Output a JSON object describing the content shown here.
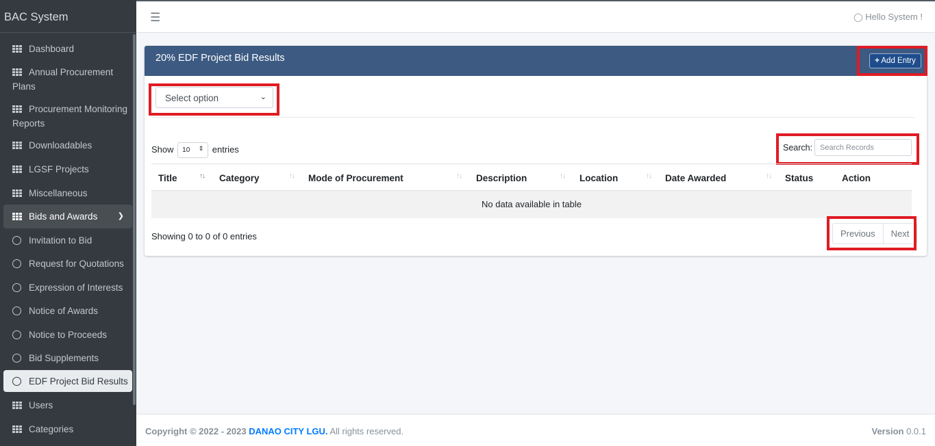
{
  "brand": "BAC System",
  "sidebar": {
    "items": [
      {
        "label": "Dashboard",
        "icon": "grid-icon"
      },
      {
        "label": "Annual Procurement Plans",
        "icon": "grid-icon"
      },
      {
        "label": "Procurement Monitoring Reports",
        "icon": "grid-icon"
      },
      {
        "label": "Downloadables",
        "icon": "grid-icon"
      },
      {
        "label": "LGSF Projects",
        "icon": "grid-icon"
      },
      {
        "label": "Miscellaneous",
        "icon": "grid-icon"
      },
      {
        "label": "Bids and Awards",
        "icon": "grid-icon"
      },
      {
        "label": "Invitation to Bid",
        "icon": "circle-icon"
      },
      {
        "label": "Request for Quotations",
        "icon": "circle-icon"
      },
      {
        "label": "Expression of Interests",
        "icon": "circle-icon"
      },
      {
        "label": "Notice of Awards",
        "icon": "circle-icon"
      },
      {
        "label": "Notice to Proceeds",
        "icon": "circle-icon"
      },
      {
        "label": "Bid Supplements",
        "icon": "circle-icon"
      },
      {
        "label": "EDF Project Bid Results",
        "icon": "circle-icon"
      },
      {
        "label": "Users",
        "icon": "grid-icon"
      },
      {
        "label": "Categories",
        "icon": "grid-icon"
      }
    ]
  },
  "navbar": {
    "user_text": "Hello System !"
  },
  "card": {
    "title": "20% EDF Project Bid Results",
    "add_label": "Add Entry",
    "select_value": "Select option",
    "show_label": "Show",
    "length_value": "10",
    "entries_label": "entries",
    "search_label": "Search:",
    "search_placeholder": "Search Records",
    "columns": [
      "Title",
      "Category",
      "Mode of Procurement",
      "Description",
      "Location",
      "Date Awarded",
      "Status",
      "Action"
    ],
    "empty_text": "No data available in table",
    "info_text": "Showing 0 to 0 of 0 entries",
    "prev_label": "Previous",
    "next_label": "Next"
  },
  "footer": {
    "copyright": "Copyright © 2022 - 2023",
    "org": "DANAO CITY LGU.",
    "rights": "All rights reserved.",
    "version_label": "Version",
    "version_value": "0.0.1"
  },
  "colors": {
    "header_bg": "#3c5a82",
    "sidebar_bg": "#343a40",
    "highlight": "#e01b24",
    "link": "#007bff"
  }
}
